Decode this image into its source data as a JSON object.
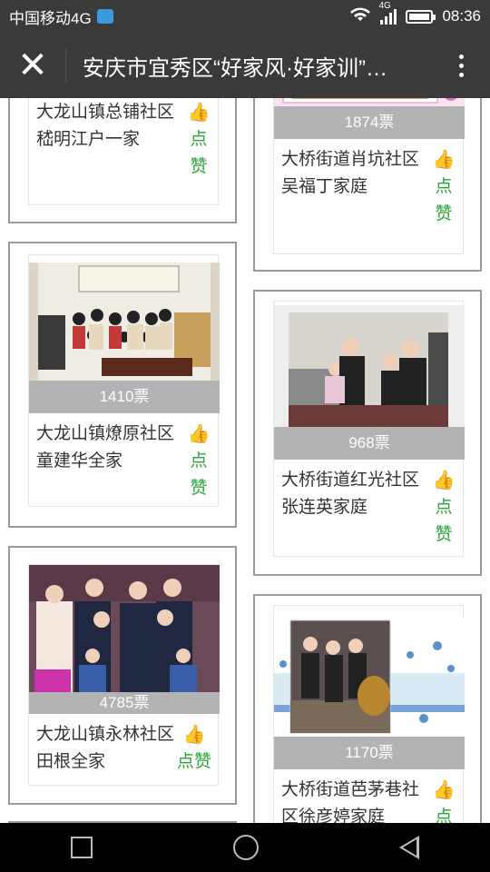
{
  "status": {
    "carrier": "中国移动4G",
    "time": "08:36",
    "network": "4G"
  },
  "header": {
    "title": "安庆市宜秀区“好家风·好家训”…",
    "close_icon": "close-icon",
    "more_icon": "more-vertical-icon"
  },
  "left_column": [
    {
      "name": "大龙山镇总铺社区嵇明江户一家",
      "votes": "",
      "like": "点赞"
    },
    {
      "name": "大龙山镇燎原社区童建华全家",
      "votes": "1410票",
      "like": "点赞"
    },
    {
      "name": "大龙山镇永林社区田根全家",
      "votes": "4785票",
      "like": "点赞"
    }
  ],
  "right_column": [
    {
      "name": "大桥街道肖坑社区吴福丁家庭",
      "votes": "1874票",
      "like": "点赞"
    },
    {
      "name": "大桥街道红光社区张连英家庭",
      "votes": "968票",
      "like": "点赞"
    },
    {
      "name": "大桥街道芭茅巷社区徐彦婷家庭",
      "votes": "1170票",
      "like": "点赞"
    }
  ],
  "nav": {
    "recents_icon": "square-icon",
    "home_icon": "circle-icon",
    "back_icon": "triangle-back-icon"
  },
  "colors": {
    "header_bg": "#3a3a3a",
    "like_green": "#2aa53a",
    "vote_bar": "#b3b3b3"
  }
}
